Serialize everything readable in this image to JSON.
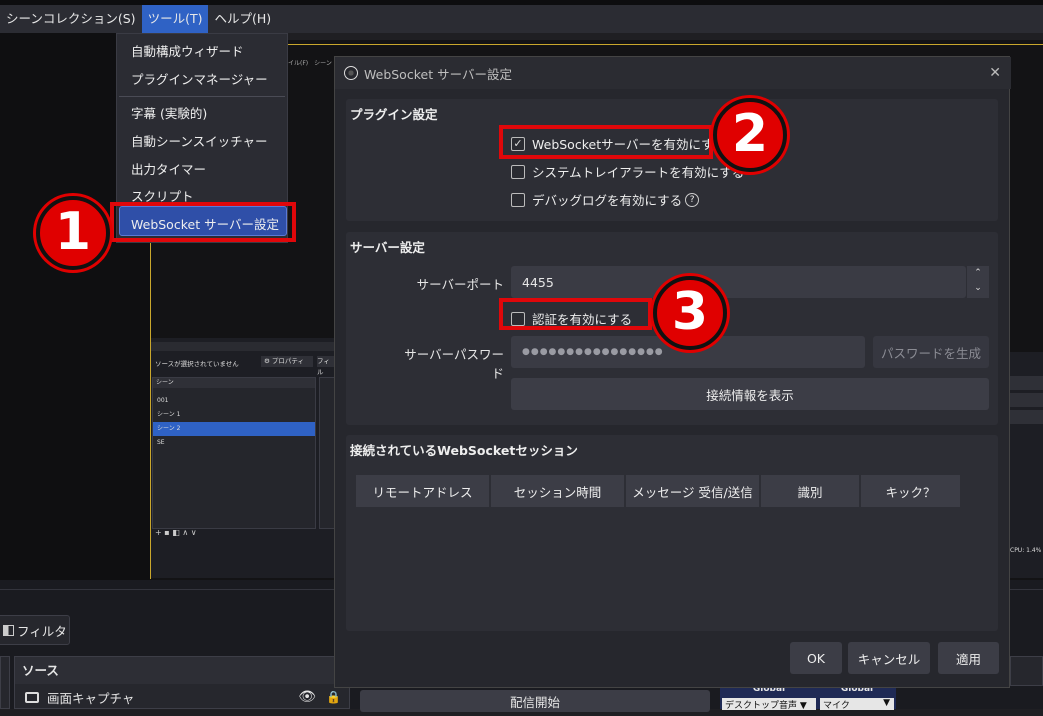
{
  "menubar": {
    "items": [
      "シーンコレクション(S)",
      "ツール(T)",
      "ヘルプ(H)"
    ]
  },
  "tools_menu": {
    "items": [
      "自動構成ウィザード",
      "プラグインマネージャー",
      "字幕 (実験的)",
      "自動シーンスイッチャー",
      "出力タイマー",
      "スクリプト",
      "WebSocket サーバー設定"
    ]
  },
  "markers": [
    "1",
    "2",
    "3"
  ],
  "dialog": {
    "title": "WebSocket サーバー設定",
    "close": "✕",
    "plugin_group": {
      "title": "プラグイン設定",
      "enable_server": {
        "label": "WebSocketサーバーを有効にする",
        "checked": true
      },
      "tray_alert": {
        "label": "システムトレイアラートを有効にする",
        "checked": false
      },
      "debug_log": {
        "label": "デバッグログを有効にする",
        "checked": false
      }
    },
    "server_group": {
      "title": "サーバー設定",
      "port_label": "サーバーポート",
      "port_value": "4455",
      "auth": {
        "label": "認証を有効にする",
        "checked": false
      },
      "password_label": "サーバーパスワード",
      "password_value": "●●●●●●●●●●●●●●●●",
      "generate_password": "パスワードを生成",
      "show_connect_info": "接続情報を表示"
    },
    "sessions_group": {
      "title": "接続されているWebSocketセッション",
      "columns": [
        "リモートアドレス",
        "セッション時間",
        "メッセージ 受信/送信",
        "識別",
        "キック？"
      ]
    },
    "buttons": {
      "ok": "OK",
      "cancel": "キャンセル",
      "apply": "適用"
    }
  },
  "mini_obs": {
    "no_source": "ソースが選択されていません",
    "properties": "プロパティ",
    "filter": "フィル",
    "scenes_header": "シーン",
    "scenes": [
      "001",
      "シーン 1",
      "シーン 2",
      "SE"
    ],
    "cpu": "CPU: 1.4%"
  },
  "bottom": {
    "filter_button": "フィルタ",
    "sources_header": "ソース",
    "source_item": "画面キャプチャ",
    "start_stream": "配信開始",
    "mixer_global_1": "Global",
    "mixer_global_2": "Global",
    "mixer_desktop": "デスクトップ音声",
    "mixer_mic": "マイク"
  }
}
